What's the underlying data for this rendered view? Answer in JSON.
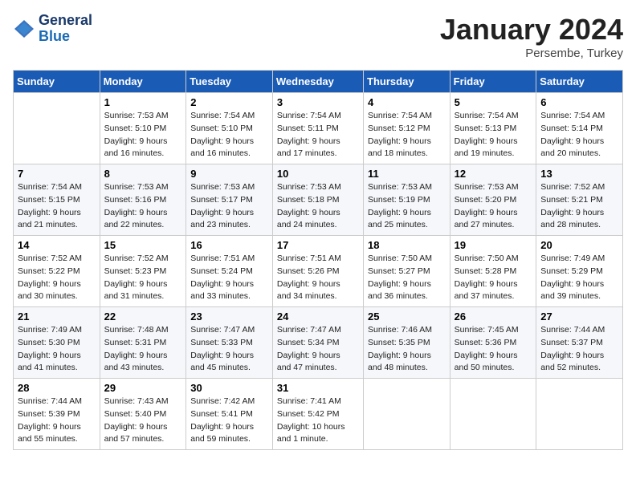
{
  "header": {
    "logo_line1": "General",
    "logo_line2": "Blue",
    "title": "January 2024",
    "subtitle": "Persembe, Turkey"
  },
  "calendar": {
    "days_of_week": [
      "Sunday",
      "Monday",
      "Tuesday",
      "Wednesday",
      "Thursday",
      "Friday",
      "Saturday"
    ],
    "weeks": [
      [
        {
          "num": "",
          "info": ""
        },
        {
          "num": "1",
          "info": "Sunrise: 7:53 AM\nSunset: 5:10 PM\nDaylight: 9 hours\nand 16 minutes."
        },
        {
          "num": "2",
          "info": "Sunrise: 7:54 AM\nSunset: 5:10 PM\nDaylight: 9 hours\nand 16 minutes."
        },
        {
          "num": "3",
          "info": "Sunrise: 7:54 AM\nSunset: 5:11 PM\nDaylight: 9 hours\nand 17 minutes."
        },
        {
          "num": "4",
          "info": "Sunrise: 7:54 AM\nSunset: 5:12 PM\nDaylight: 9 hours\nand 18 minutes."
        },
        {
          "num": "5",
          "info": "Sunrise: 7:54 AM\nSunset: 5:13 PM\nDaylight: 9 hours\nand 19 minutes."
        },
        {
          "num": "6",
          "info": "Sunrise: 7:54 AM\nSunset: 5:14 PM\nDaylight: 9 hours\nand 20 minutes."
        }
      ],
      [
        {
          "num": "7",
          "info": "Sunrise: 7:54 AM\nSunset: 5:15 PM\nDaylight: 9 hours\nand 21 minutes."
        },
        {
          "num": "8",
          "info": "Sunrise: 7:53 AM\nSunset: 5:16 PM\nDaylight: 9 hours\nand 22 minutes."
        },
        {
          "num": "9",
          "info": "Sunrise: 7:53 AM\nSunset: 5:17 PM\nDaylight: 9 hours\nand 23 minutes."
        },
        {
          "num": "10",
          "info": "Sunrise: 7:53 AM\nSunset: 5:18 PM\nDaylight: 9 hours\nand 24 minutes."
        },
        {
          "num": "11",
          "info": "Sunrise: 7:53 AM\nSunset: 5:19 PM\nDaylight: 9 hours\nand 25 minutes."
        },
        {
          "num": "12",
          "info": "Sunrise: 7:53 AM\nSunset: 5:20 PM\nDaylight: 9 hours\nand 27 minutes."
        },
        {
          "num": "13",
          "info": "Sunrise: 7:52 AM\nSunset: 5:21 PM\nDaylight: 9 hours\nand 28 minutes."
        }
      ],
      [
        {
          "num": "14",
          "info": "Sunrise: 7:52 AM\nSunset: 5:22 PM\nDaylight: 9 hours\nand 30 minutes."
        },
        {
          "num": "15",
          "info": "Sunrise: 7:52 AM\nSunset: 5:23 PM\nDaylight: 9 hours\nand 31 minutes."
        },
        {
          "num": "16",
          "info": "Sunrise: 7:51 AM\nSunset: 5:24 PM\nDaylight: 9 hours\nand 33 minutes."
        },
        {
          "num": "17",
          "info": "Sunrise: 7:51 AM\nSunset: 5:26 PM\nDaylight: 9 hours\nand 34 minutes."
        },
        {
          "num": "18",
          "info": "Sunrise: 7:50 AM\nSunset: 5:27 PM\nDaylight: 9 hours\nand 36 minutes."
        },
        {
          "num": "19",
          "info": "Sunrise: 7:50 AM\nSunset: 5:28 PM\nDaylight: 9 hours\nand 37 minutes."
        },
        {
          "num": "20",
          "info": "Sunrise: 7:49 AM\nSunset: 5:29 PM\nDaylight: 9 hours\nand 39 minutes."
        }
      ],
      [
        {
          "num": "21",
          "info": "Sunrise: 7:49 AM\nSunset: 5:30 PM\nDaylight: 9 hours\nand 41 minutes."
        },
        {
          "num": "22",
          "info": "Sunrise: 7:48 AM\nSunset: 5:31 PM\nDaylight: 9 hours\nand 43 minutes."
        },
        {
          "num": "23",
          "info": "Sunrise: 7:47 AM\nSunset: 5:33 PM\nDaylight: 9 hours\nand 45 minutes."
        },
        {
          "num": "24",
          "info": "Sunrise: 7:47 AM\nSunset: 5:34 PM\nDaylight: 9 hours\nand 47 minutes."
        },
        {
          "num": "25",
          "info": "Sunrise: 7:46 AM\nSunset: 5:35 PM\nDaylight: 9 hours\nand 48 minutes."
        },
        {
          "num": "26",
          "info": "Sunrise: 7:45 AM\nSunset: 5:36 PM\nDaylight: 9 hours\nand 50 minutes."
        },
        {
          "num": "27",
          "info": "Sunrise: 7:44 AM\nSunset: 5:37 PM\nDaylight: 9 hours\nand 52 minutes."
        }
      ],
      [
        {
          "num": "28",
          "info": "Sunrise: 7:44 AM\nSunset: 5:39 PM\nDaylight: 9 hours\nand 55 minutes."
        },
        {
          "num": "29",
          "info": "Sunrise: 7:43 AM\nSunset: 5:40 PM\nDaylight: 9 hours\nand 57 minutes."
        },
        {
          "num": "30",
          "info": "Sunrise: 7:42 AM\nSunset: 5:41 PM\nDaylight: 9 hours\nand 59 minutes."
        },
        {
          "num": "31",
          "info": "Sunrise: 7:41 AM\nSunset: 5:42 PM\nDaylight: 10 hours\nand 1 minute."
        },
        {
          "num": "",
          "info": ""
        },
        {
          "num": "",
          "info": ""
        },
        {
          "num": "",
          "info": ""
        }
      ]
    ]
  }
}
